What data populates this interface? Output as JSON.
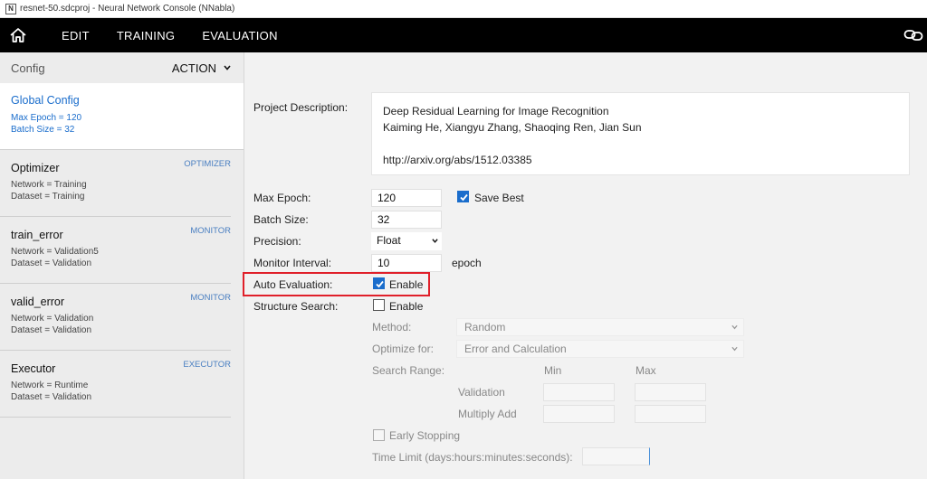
{
  "window": {
    "title": "resnet-50.sdcproj - Neural Network Console (NNabla)",
    "app_icon_letter": "N"
  },
  "menu": {
    "items": [
      "EDIT",
      "TRAINING",
      "EVALUATION"
    ]
  },
  "sidebar": {
    "header_label": "Config",
    "action_label": "ACTION",
    "items": [
      {
        "name": "Global Config",
        "kind": "",
        "details": [
          "Max Epoch = 120",
          "Batch Size = 32"
        ]
      },
      {
        "name": "Optimizer",
        "kind": "OPTIMIZER",
        "details": [
          "Network = Training",
          "Dataset = Training"
        ]
      },
      {
        "name": "train_error",
        "kind": "MONITOR",
        "details": [
          "Network = Validation5",
          "Dataset = Validation"
        ]
      },
      {
        "name": "valid_error",
        "kind": "MONITOR",
        "details": [
          "Network = Validation",
          "Dataset = Validation"
        ]
      },
      {
        "name": "Executor",
        "kind": "EXECUTOR",
        "details": [
          "Network = Runtime",
          "Dataset = Validation"
        ]
      }
    ]
  },
  "config": {
    "project_description_label": "Project Description:",
    "project_description": "Deep Residual Learning for Image Recognition\nKaiming He, Xiangyu Zhang, Shaoqing Ren, Jian Sun\n\nhttp://arxiv.org/abs/1512.03385",
    "max_epoch_label": "Max Epoch:",
    "max_epoch": "120",
    "save_best_label": "Save Best",
    "save_best_checked": true,
    "batch_size_label": "Batch Size:",
    "batch_size": "32",
    "precision_label": "Precision:",
    "precision": "Float",
    "monitor_interval_label": "Monitor Interval:",
    "monitor_interval": "10",
    "monitor_interval_unit": "epoch",
    "auto_evaluation_label": "Auto Evaluation:",
    "auto_evaluation_enable_label": "Enable",
    "auto_evaluation_checked": true,
    "structure_search_label": "Structure Search:",
    "structure_search_enable_label": "Enable",
    "structure_search_checked": false,
    "method_label": "Method:",
    "method": "Random",
    "optimize_for_label": "Optimize for:",
    "optimize_for": "Error and Calculation",
    "search_range_label": "Search Range:",
    "min_label": "Min",
    "max_label": "Max",
    "validation_label": "Validation",
    "multiply_add_label": "Multiply Add",
    "early_stopping_label": "Early Stopping",
    "time_limit_label": "Time Limit (days:hours:minutes:seconds):"
  },
  "colors": {
    "accent": "#1a6dcc",
    "highlight": "#e0202a",
    "menubar": "#000000"
  }
}
